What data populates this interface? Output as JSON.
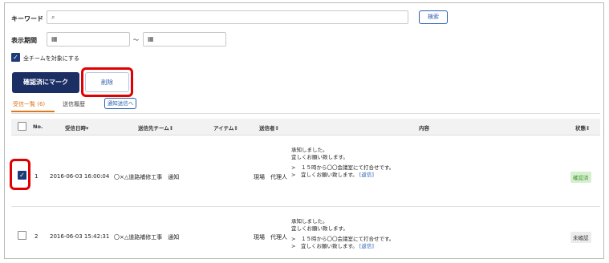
{
  "search": {
    "keyword_label": "キーワード",
    "keyword_value": "",
    "search_button": "検索",
    "period_label": "表示期間",
    "range_separator": "〜",
    "all_teams_label": "全チームを対象にする"
  },
  "actions": {
    "mark_confirmed": "確認済にマーク",
    "delete": "削除"
  },
  "tabs": {
    "received": "受信一覧 (6)",
    "sent": "送信履歴",
    "notify_send": "通知送信へ"
  },
  "table": {
    "headers": {
      "no": "No.",
      "received_at": "受信日時▾",
      "dest_team": "送信先チーム↕",
      "item": "アイテム↕",
      "sender": "送信者↕",
      "content": "内容",
      "status": "状態↕"
    },
    "rows": [
      {
        "no": "1",
        "received_at": "2016-06-03 16:00:04",
        "dest_team": "〇×△道路補修工事　通知",
        "item": "",
        "sender": "現場　代理人",
        "line1": "承知しました。",
        "line2": "宜しくお願い致します。",
        "quote1": ">　１５時から〇〇会議室にて打合せです。",
        "quote2": ">　宜しくお願い致します。",
        "reply": "[返信]",
        "status": "確認済",
        "checked": true
      },
      {
        "no": "2",
        "received_at": "2016-06-03 15:42:31",
        "dest_team": "〇×△道路補修工事　通知",
        "item": "",
        "sender": "現場　代理人",
        "line1": "承知しました。",
        "line2": "宜しくお願い致します。",
        "quote1": ">　１５時から〇〇会議室にて打合せです。",
        "quote2": ">　宜しくお願い致します。",
        "reply": "[返信]",
        "status": "未確認",
        "checked": false
      }
    ]
  },
  "icons": {
    "search": "search-icon",
    "calendar": "calendar-icon",
    "check": "checkmark"
  },
  "colors": {
    "navy": "#1c2f64",
    "accent_blue": "#2a5fb0",
    "highlight_red": "#e00000",
    "tab_orange": "#e0761b",
    "confirmed_bg": "#d6f0cf",
    "confirmed_text": "#3c8a2c",
    "unconfirmed_bg": "#ececec"
  }
}
